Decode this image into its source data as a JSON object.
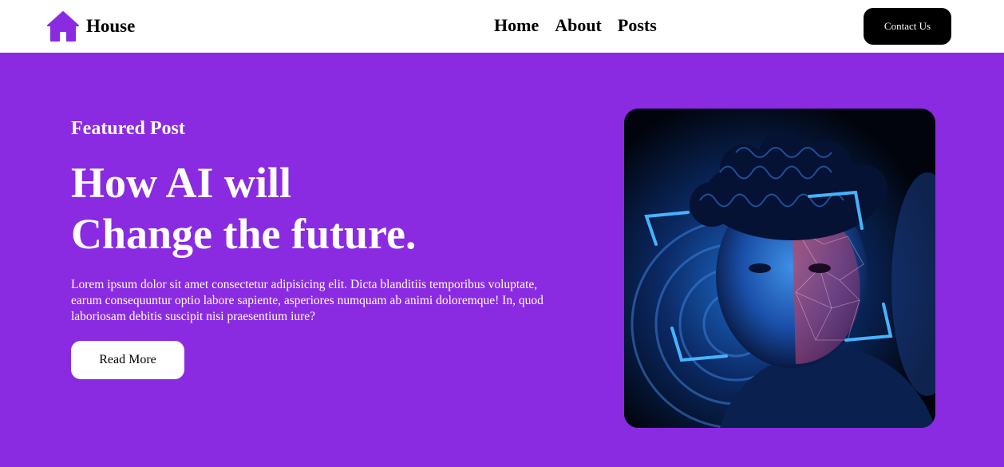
{
  "nav": {
    "brand": "House",
    "links": [
      "Home",
      "About",
      "Posts"
    ],
    "cta": "Contact Us"
  },
  "hero": {
    "eyebrow": "Featured Post",
    "title_line1": "How AI will",
    "title_line2": "Change the future.",
    "body": "Lorem ipsum dolor sit amet consectetur adipisicing elit. Dicta blanditiis temporibus voluptate, earum consequuntur optio labore sapiente, asperiores numquam ab animi doloremque! In, quod laboriosam debitis suscipit nisi praesentium iure?",
    "button": "Read More"
  },
  "colors": {
    "accent": "#8a2be2",
    "nav_bg": "#ffffff",
    "cta_bg": "#000000"
  },
  "icons": {
    "logo": "house-icon"
  }
}
